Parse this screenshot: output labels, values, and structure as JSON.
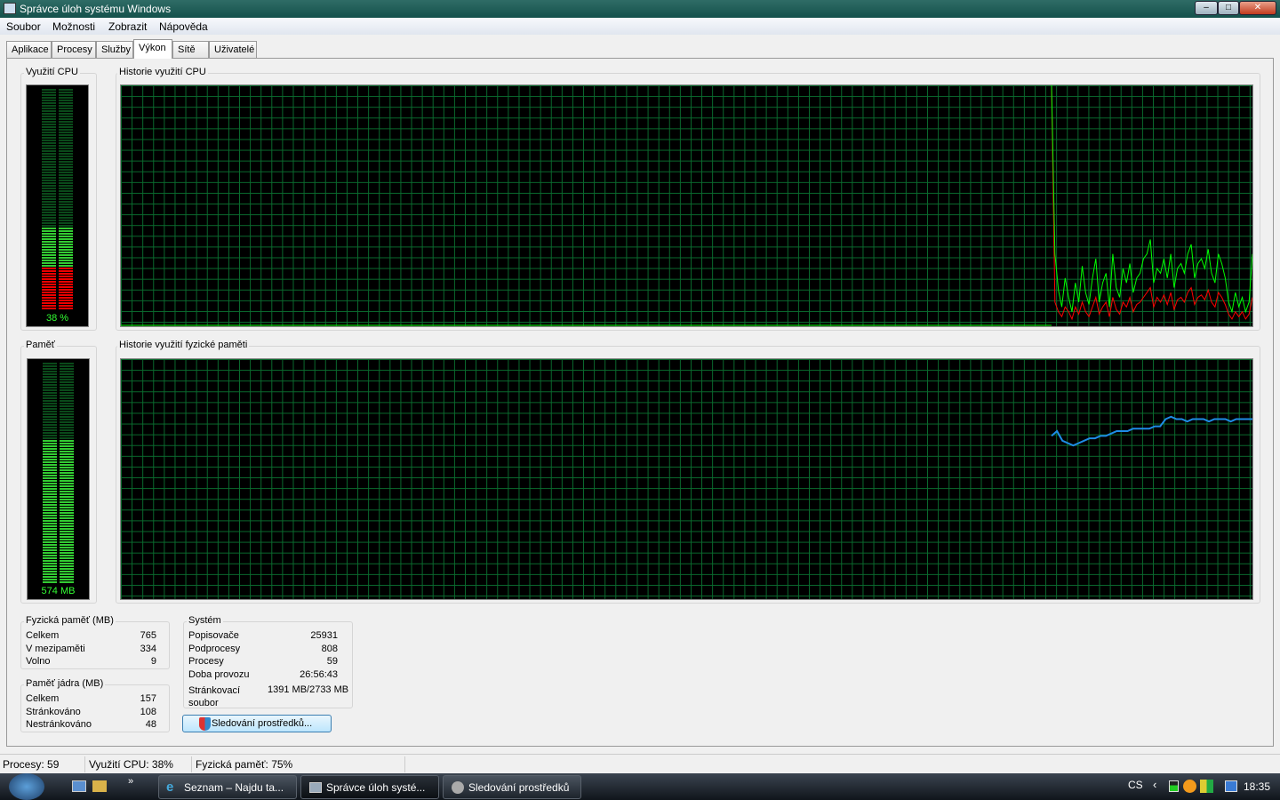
{
  "window": {
    "title": "Správce úloh systému Windows"
  },
  "menu": [
    "Soubor",
    "Možnosti",
    "Zobrazit",
    "Nápověda"
  ],
  "tabs": [
    {
      "label": "Aplikace"
    },
    {
      "label": "Procesy"
    },
    {
      "label": "Služby"
    },
    {
      "label": "Výkon",
      "active": true
    },
    {
      "label": "Sítě"
    },
    {
      "label": "Uživatelé"
    }
  ],
  "cpu": {
    "label": "Využití CPU",
    "value_text": "38 %",
    "percent": 38,
    "kernel_percent": 20,
    "history_label": "Historie využití CPU"
  },
  "memory": {
    "label": "Paměť",
    "value_text": "574 MB",
    "percent": 75,
    "history_label": "Historie využití fyzické paměti"
  },
  "chart_data": [
    {
      "type": "line",
      "title": "Historie využití CPU",
      "ylim": [
        0,
        100
      ],
      "series": [
        {
          "name": "CPU total",
          "color": "#00ff00",
          "values": [
            100,
            30,
            15,
            8,
            20,
            12,
            6,
            18,
            10,
            25,
            14,
            9,
            20,
            28,
            10,
            18,
            22,
            8,
            30,
            16,
            12,
            24,
            18,
            26,
            14,
            20,
            22,
            28,
            30,
            36,
            18,
            24,
            22,
            28,
            20,
            30,
            16,
            24,
            26,
            22,
            30,
            34,
            20,
            26,
            28,
            24,
            32,
            22,
            18,
            30,
            26,
            20,
            10,
            6,
            14,
            8,
            12,
            6,
            10,
            30
          ]
        },
        {
          "name": "Kernel",
          "color": "#ff0000",
          "values": [
            100,
            10,
            6,
            4,
            8,
            6,
            3,
            8,
            5,
            10,
            6,
            4,
            8,
            12,
            5,
            8,
            10,
            4,
            12,
            7,
            5,
            10,
            8,
            12,
            6,
            9,
            10,
            12,
            14,
            16,
            8,
            12,
            10,
            13,
            9,
            14,
            7,
            11,
            12,
            10,
            14,
            16,
            9,
            12,
            13,
            11,
            15,
            10,
            8,
            14,
            12,
            9,
            5,
            3,
            6,
            4,
            6,
            3,
            5,
            12
          ]
        }
      ]
    },
    {
      "type": "line",
      "title": "Historie využití fyzické paměti",
      "ylim": [
        0,
        100
      ],
      "series": [
        {
          "name": "Memory",
          "color": "#1e8ce6",
          "values": [
            68,
            70,
            66,
            65,
            64,
            65,
            66,
            67,
            67,
            68,
            68,
            69,
            70,
            70,
            70,
            71,
            71,
            71,
            71,
            72,
            72,
            75,
            76,
            75,
            75,
            74,
            75,
            75,
            75,
            74,
            75,
            75,
            75,
            74,
            75,
            75,
            75,
            75
          ]
        }
      ]
    }
  ],
  "physical_memory": {
    "label": "Fyzická paměť (MB)",
    "rows": [
      {
        "k": "Celkem",
        "v": "765"
      },
      {
        "k": "V mezipaměti",
        "v": "334"
      },
      {
        "k": "Volno",
        "v": "9"
      }
    ]
  },
  "kernel_memory": {
    "label": "Paměť jádra (MB)",
    "rows": [
      {
        "k": "Celkem",
        "v": "157"
      },
      {
        "k": "Stránkováno",
        "v": "108"
      },
      {
        "k": "Nestránkováno",
        "v": "48"
      }
    ]
  },
  "system": {
    "label": "Systém",
    "rows": [
      {
        "k": "Popisovače",
        "v": "25931"
      },
      {
        "k": "Podprocesy",
        "v": "808"
      },
      {
        "k": "Procesy",
        "v": "59"
      },
      {
        "k": "Doba provozu",
        "v": "26:56:43"
      }
    ],
    "pagefile_k": "Stránkovací soubor",
    "pagefile_v": "1391 MB/2733 MB"
  },
  "resource_monitor_button": "Sledování prostředků...",
  "status": {
    "processes": "Procesy: 59",
    "cpu": "Využití CPU: 38%",
    "memory": "Fyzická paměť: 75%"
  },
  "taskbar": {
    "items": [
      "Seznam – Najdu ta...",
      "Správce úloh systé...",
      "Sledování prostředků"
    ],
    "lang": "CS",
    "clock": "18:35"
  }
}
